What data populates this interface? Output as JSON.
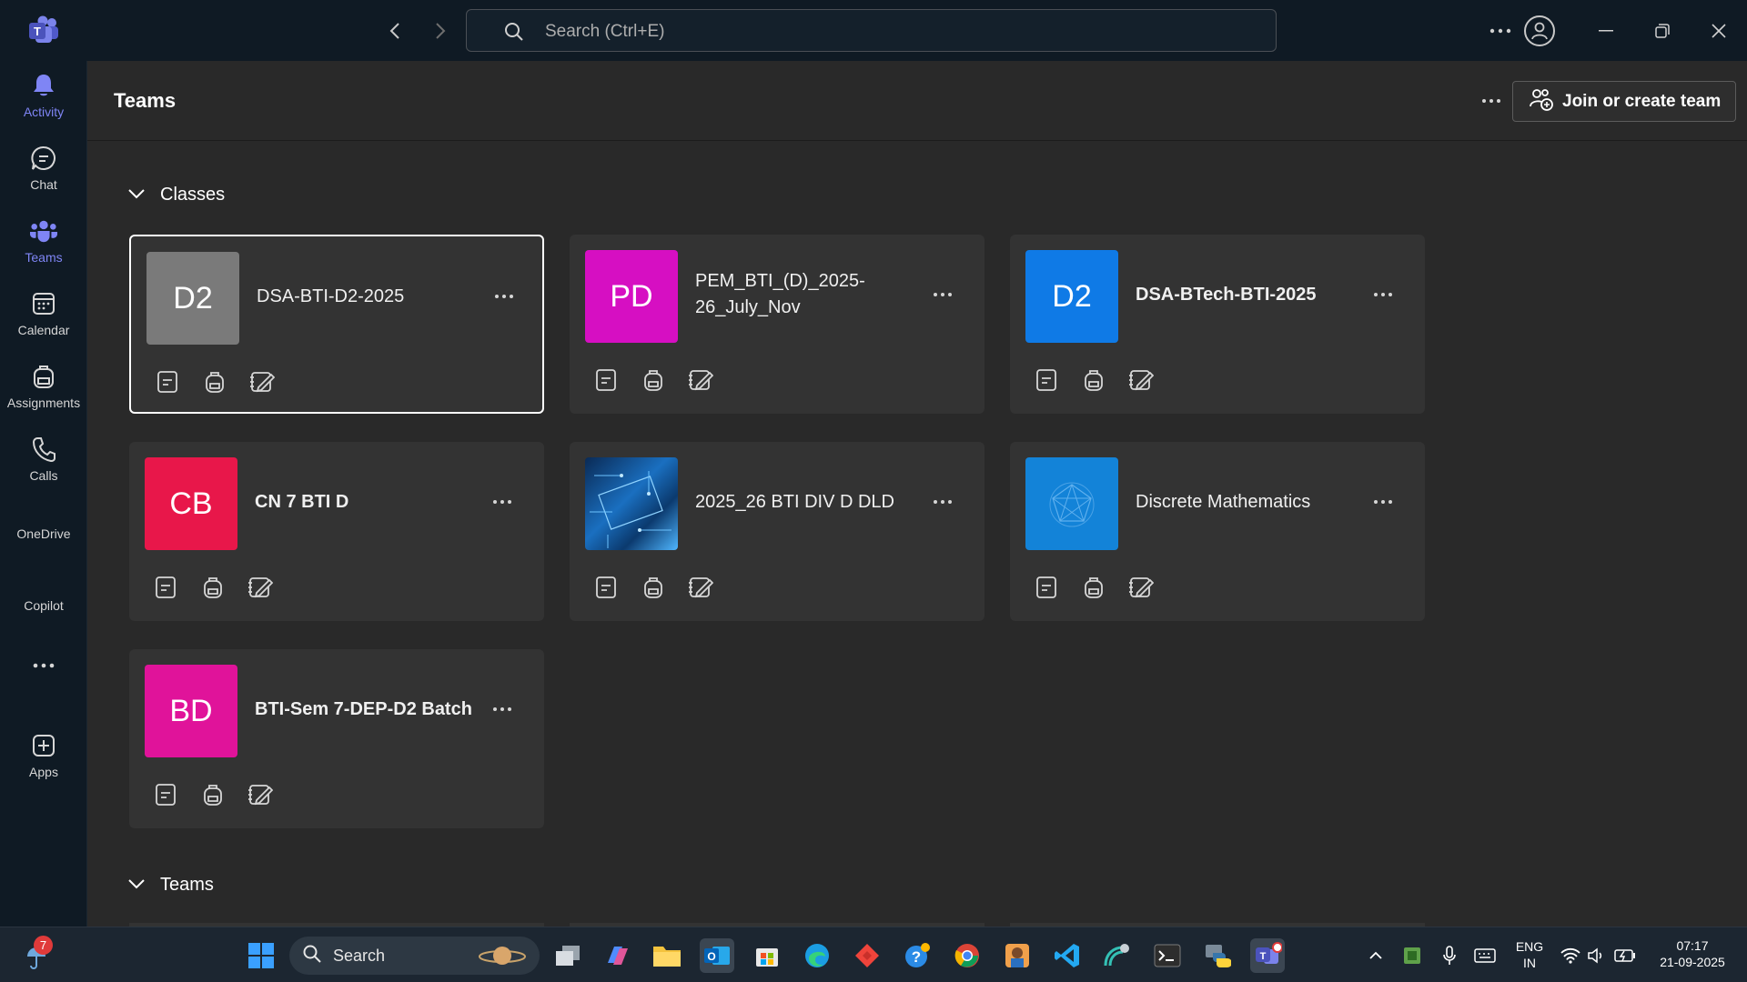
{
  "titlebar": {
    "search_placeholder": "Search (Ctrl+E)"
  },
  "rail": {
    "items": [
      {
        "label": "Activity"
      },
      {
        "label": "Chat"
      },
      {
        "label": "Teams"
      },
      {
        "label": "Calendar"
      },
      {
        "label": "Assignments"
      },
      {
        "label": "Calls"
      },
      {
        "label": "OneDrive"
      },
      {
        "label": "Copilot"
      },
      {
        "label": "Apps"
      }
    ]
  },
  "header": {
    "title": "Teams",
    "join_label": "Join or create team"
  },
  "sections": {
    "classes": "Classes",
    "teams": "Teams"
  },
  "cards": [
    {
      "initials": "D2",
      "name": "DSA-BTI-D2-2025",
      "color": "#7a7a7a"
    },
    {
      "initials": "PD",
      "name": "PEM_BTI_(D)_2025-26_July_Nov",
      "color": "#d60fc2"
    },
    {
      "initials": "D2",
      "name": "DSA-BTech-BTI-2025",
      "color": "#0f7ae6"
    },
    {
      "initials": "CB",
      "name": "CN 7 BTI D",
      "color": "#e8174a"
    },
    {
      "initials": "",
      "name": "2025_26 BTI DIV D DLD",
      "color": "#0b3a6e"
    },
    {
      "initials": "",
      "name": "Discrete Mathematics",
      "color": "#1383d8"
    },
    {
      "initials": "BD",
      "name": "BTI-Sem 7-DEP-D2 Batch",
      "color": "#e0139a"
    }
  ],
  "taskbar": {
    "notification_count": "7",
    "search_label": "Search",
    "lang_line1": "ENG",
    "lang_line2": "IN",
    "time": "07:17",
    "date": "21-09-2025"
  },
  "colors": {
    "accent": "#7f85f5",
    "background": "#292929",
    "card": "#333333",
    "rail": "#0f1a24"
  }
}
